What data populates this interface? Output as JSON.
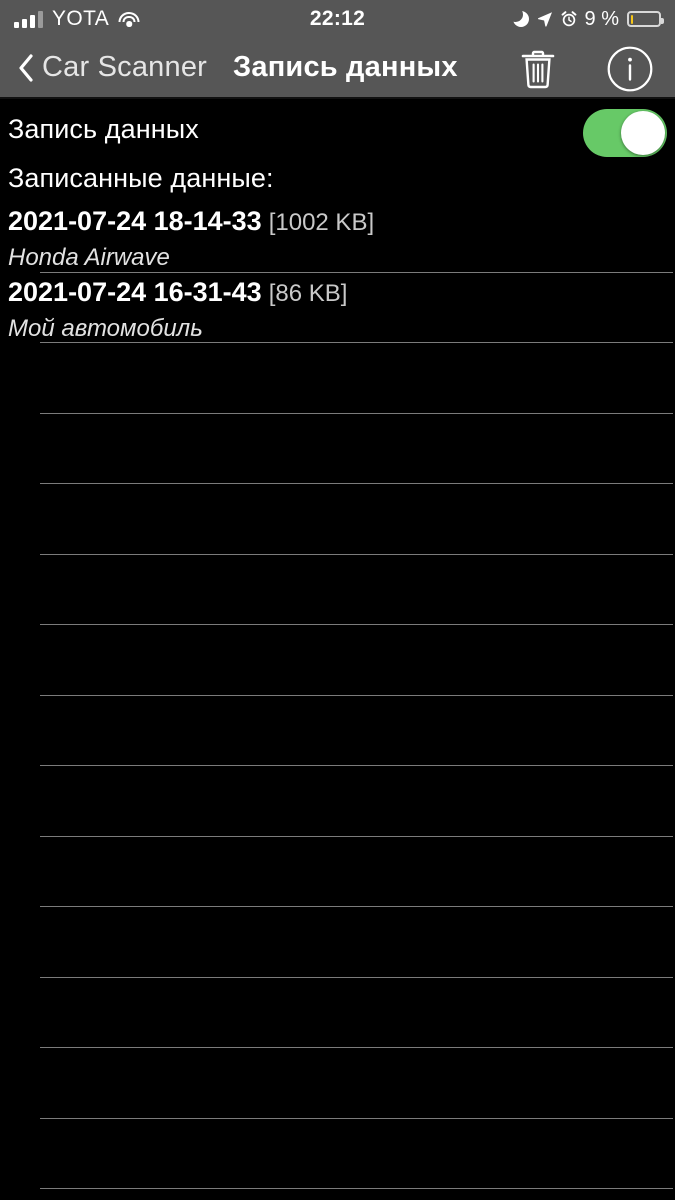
{
  "status_bar": {
    "carrier": "YOTA",
    "time": "22:12",
    "battery_percent": "9 %",
    "signal_icon": "signal-bars-icon",
    "wifi_icon": "wifi-icon",
    "moon_icon": "moon-do-not-disturb-icon",
    "location_icon": "location-arrow-icon",
    "alarm_icon": "alarm-clock-icon",
    "battery_icon": "battery-low-power-icon",
    "battery_fill_color": "#f5c518"
  },
  "nav_bar": {
    "back_label": "Car Scanner",
    "back_icon": "chevron-left-icon",
    "title": "Запись данных",
    "delete_icon": "trash-icon",
    "info_icon": "info-circle-icon",
    "background_color": "#565656"
  },
  "toggle_row": {
    "label": "Запись данных",
    "enabled": true,
    "on_color": "#67c967"
  },
  "section": {
    "header": "Записанные данные:"
  },
  "recordings": [
    {
      "name": "2021-07-24 18-14-33",
      "size": "[1002 KB]",
      "vehicle": "Honda Airwave"
    },
    {
      "name": "2021-07-24 16-31-43",
      "size": "[86 KB]",
      "vehicle": "Мой автомобиль"
    }
  ],
  "empty_rows": 12,
  "separator_color": "#7b7b7b",
  "background_color": "#000000"
}
